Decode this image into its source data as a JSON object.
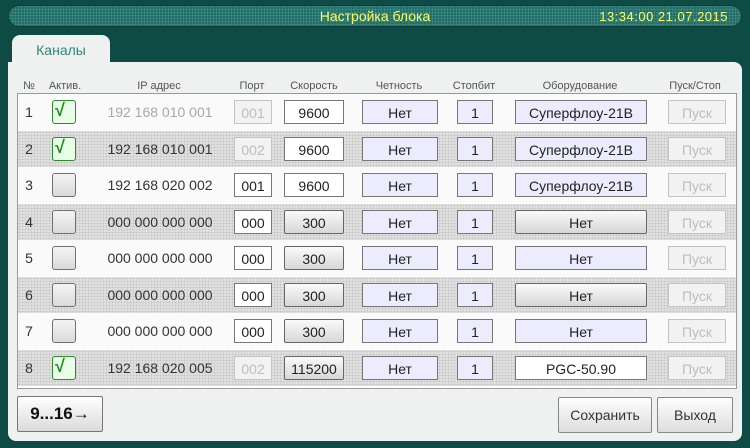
{
  "title": "Настройка блока",
  "datetime": "13:34:00  21.07.2015",
  "tab_label": "Каналы",
  "headers": {
    "num": "№",
    "active": "Актив.",
    "ip": "IP адрес",
    "port": "Порт",
    "speed": "Скорость",
    "parity": "Четность",
    "stopbit": "Стопбит",
    "equipment": "Оборудование",
    "startstop": "Пуск/Стоп"
  },
  "rows": [
    {
      "num": "1",
      "active": true,
      "ip": "192 168 010 001",
      "ip_dim": true,
      "port": "001",
      "port_dim": true,
      "speed": "9600",
      "speed_field": true,
      "parity": "Нет",
      "stopbit": "1",
      "equipment": "Суперфлоу-21В",
      "equipment_style": "sel",
      "start": "Пуск"
    },
    {
      "num": "2",
      "active": true,
      "ip": "192 168 010 001",
      "ip_dim": false,
      "port": "002",
      "port_dim": true,
      "speed": "9600",
      "speed_field": true,
      "parity": "Нет",
      "stopbit": "1",
      "equipment": "Суперфлоу-21В",
      "equipment_style": "sel",
      "start": "Пуск"
    },
    {
      "num": "3",
      "active": false,
      "ip": "192 168 020 002",
      "ip_dim": false,
      "port": "001",
      "port_dim": false,
      "speed": "9600",
      "speed_field": true,
      "parity": "Нет",
      "stopbit": "1",
      "equipment": "Суперфлоу-21В",
      "equipment_style": "sel",
      "start": "Пуск"
    },
    {
      "num": "4",
      "active": false,
      "ip": "000 000 000 000",
      "ip_dim": false,
      "port": "000",
      "port_dim": false,
      "speed": "300",
      "speed_field": false,
      "parity": "Нет",
      "stopbit": "1",
      "equipment": "Нет",
      "equipment_style": "btn",
      "start": "Пуск"
    },
    {
      "num": "5",
      "active": false,
      "ip": "000 000 000 000",
      "ip_dim": false,
      "port": "000",
      "port_dim": false,
      "speed": "300",
      "speed_field": false,
      "parity": "Нет",
      "stopbit": "1",
      "equipment": "Нет",
      "equipment_style": "sel",
      "start": "Пуск"
    },
    {
      "num": "6",
      "active": false,
      "ip": "000 000 000 000",
      "ip_dim": false,
      "port": "000",
      "port_dim": false,
      "speed": "300",
      "speed_field": false,
      "parity": "Нет",
      "stopbit": "1",
      "equipment": "Нет",
      "equipment_style": "btn",
      "start": "Пуск"
    },
    {
      "num": "7",
      "active": false,
      "ip": "000 000 000 000",
      "ip_dim": false,
      "port": "000",
      "port_dim": false,
      "speed": "300",
      "speed_field": false,
      "parity": "Нет",
      "stopbit": "1",
      "equipment": "Нет",
      "equipment_style": "sel",
      "start": "Пуск"
    },
    {
      "num": "8",
      "active": true,
      "ip": "192 168 020 005",
      "ip_dim": false,
      "port": "002",
      "port_dim": true,
      "speed": "115200",
      "speed_field": false,
      "parity": "Нет",
      "stopbit": "1",
      "equipment": "PGC-50.90",
      "equipment_style": "fld",
      "start": "Пуск"
    }
  ],
  "check_glyph": "√",
  "page_button": "9...16→",
  "save_button": "Сохранить",
  "exit_button": "Выход",
  "colors": {
    "background": "#0e4b44",
    "title_text": "#ffff66",
    "tab_text": "#2a8a74",
    "check": "#188a18"
  }
}
